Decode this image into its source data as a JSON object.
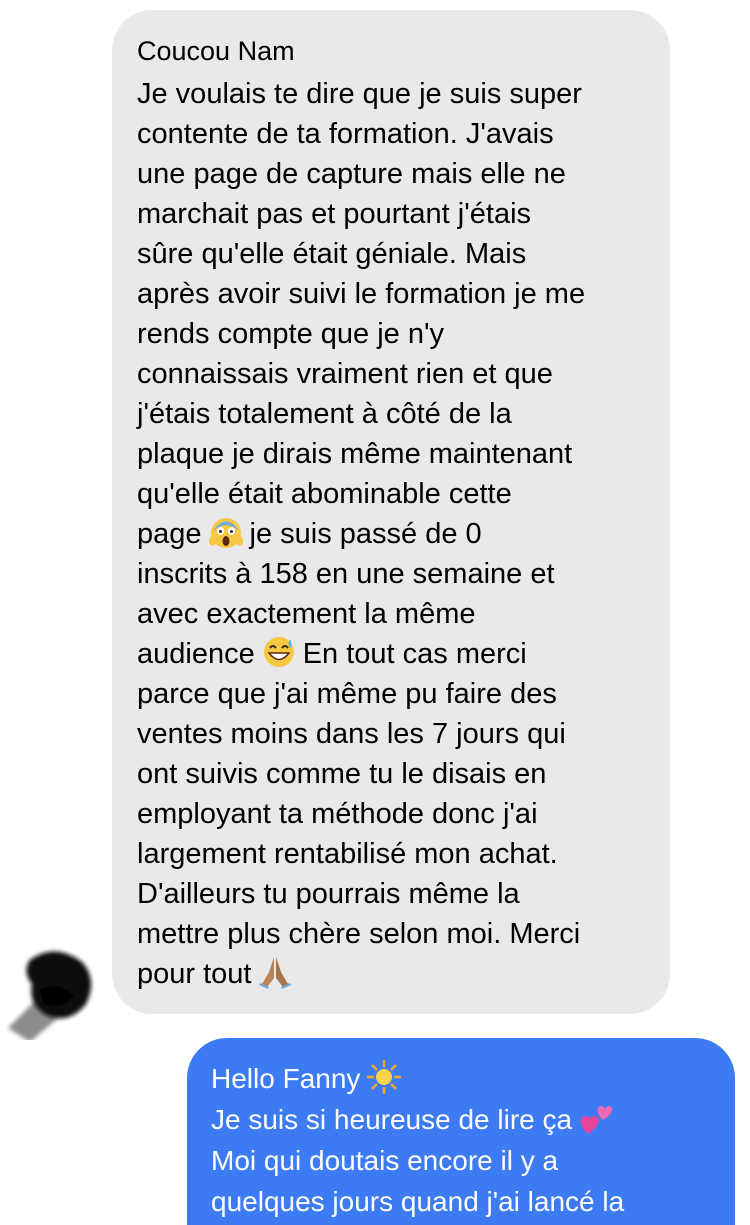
{
  "conversation": {
    "received": {
      "greeting": "Coucou Nam",
      "para1": "Je voulais te dire que je suis super\ncontente de ta formation. J'avais\nune page de capture mais elle ne\nmarchait pas et pourtant j'étais\nsûre qu'elle était géniale. Mais\naprès avoir suivi le formation je me\nrends compte que je n'y\nconnaissais vraiment rien et que\nj'étais totalement à côté de la\nplaque je dirais même maintenant\nqu'elle était abominable cette\npage",
      "para2": "je suis passé de 0\ninscrits à 158 en une semaine et\navec exactement la même\naudience",
      "para3": "En tout cas merci\nparce que j'ai même pu faire des\nventes moins dans les 7 jours qui\nont suivis comme tu le disais en\nemployant ta méthode donc j'ai\nlargement rentabilisé mon achat.\nD'ailleurs tu pourrais même la\nmettre plus chère selon moi. Merci\npour tout",
      "emoji_1": "face-screaming-in-fear",
      "emoji_2": "grinning-face-with-sweat",
      "emoji_3": "folded-hands"
    },
    "sent": {
      "line1": "Hello Fanny",
      "line2": "Je suis si heureuse de lire ça",
      "line3": "Moi qui doutais encore il y a",
      "line4": "quelques jours quand j'ai lancé la",
      "emoji_1": "sun",
      "emoji_2": "two-hearts"
    }
  },
  "colors": {
    "received_bubble": "#e9e9eb",
    "sent_bubble": "#3d7bf5",
    "sent_text": "#ffffff"
  }
}
